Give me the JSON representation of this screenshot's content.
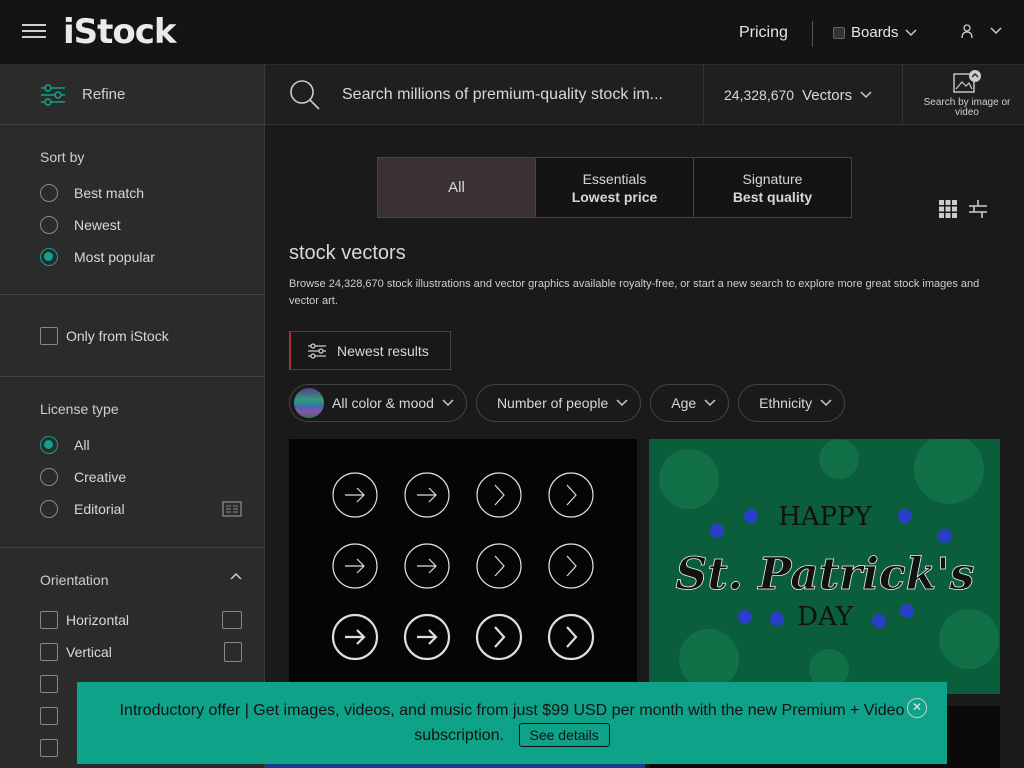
{
  "header": {
    "logo": "iStock",
    "pricing": "Pricing",
    "boards": "Boards"
  },
  "sidebar": {
    "refine": "Refine",
    "sort_title": "Sort by",
    "sort_options": [
      "Best match",
      "Newest",
      "Most popular"
    ],
    "sort_selected": "Most popular",
    "only_from": "Only from iStock",
    "license_title": "License type",
    "license_options": [
      "All",
      "Creative",
      "Editorial"
    ],
    "license_selected": "All",
    "orientation_title": "Orientation",
    "orientation_options": [
      "Horizontal",
      "Vertical"
    ]
  },
  "search": {
    "placeholder": "Search millions of premium-quality stock im...",
    "count": "24,328,670",
    "type": "Vectors",
    "search_by_image": "Search by image or video"
  },
  "tiers": {
    "all": "All",
    "essentials": "Essentials",
    "essentials_sub": "Lowest price",
    "signature": "Signature",
    "signature_sub": "Best quality"
  },
  "page": {
    "title": "stock vectors",
    "description": "Browse 24,328,670 stock illustrations and vector graphics available royalty-free, or start a new search to explore more great stock images and vector art."
  },
  "filters": {
    "newest": "Newest results",
    "color": "All color & mood",
    "people": "Number of people",
    "age": "Age",
    "ethnicity": "Ethnicity"
  },
  "thumbnail": {
    "patricks_top": "HAPPY",
    "patricks_middle": "St. Patrick's",
    "patricks_bottom": "DAY"
  },
  "promo": {
    "text": "Introductory offer | Get images, videos, and music from just $99 USD per month with the new Premium + Video subscription.",
    "cta": "See details"
  },
  "colors": {
    "accent": "#0ea389",
    "background": "#1a1a1a",
    "sidebar": "#2b2b2b"
  }
}
